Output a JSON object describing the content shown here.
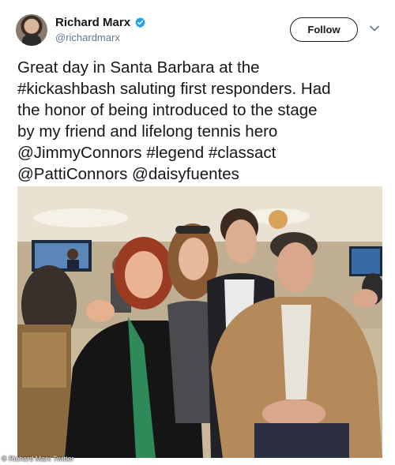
{
  "user": {
    "display_name": "Richard Marx",
    "handle": "@richardmarx",
    "verified": true
  },
  "follow_label": "Follow",
  "tweet_lines": [
    "Great day in Santa Barbara at the",
    "#kickashbash saluting first responders. Had",
    "the honor of being introduced to the stage",
    "by my friend and lifelong tennis hero",
    "@JimmyConnors #legend #classact",
    "@PattiConnors @daisyfuentes"
  ],
  "watermark": "© Richard Marx Twitter",
  "colors": {
    "verified": "#1da1f2",
    "text": "#14171a",
    "secondary": "#657786"
  },
  "icons": [
    "verified-badge-icon",
    "chevron-down-icon"
  ]
}
